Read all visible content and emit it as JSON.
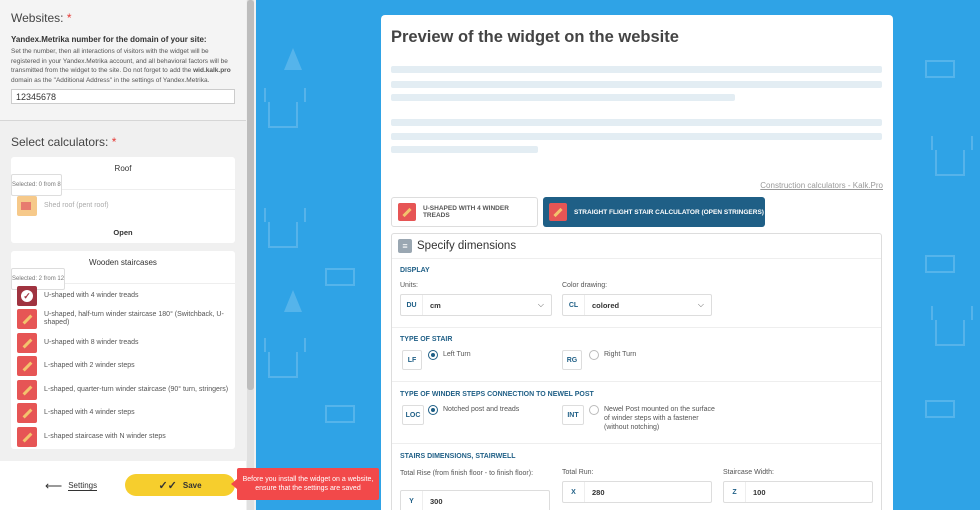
{
  "settings": {
    "websites_label": "Websites:",
    "required_mark": "*",
    "metrika_label": "Yandex.Metrika number for the domain of your site:",
    "metrika_desc_1": "Set the number, then all interactions of visitors with the widget will be registered in your Yandex.Metrika account, and all behavioral factors will be transmitted from the widget to the site. Do not forget to add the ",
    "metrika_desc_strong": "wid.kalk.pro",
    "metrika_desc_2": " domain as the \"Additional Address\" in the settings of Yandex.Metrika.",
    "metrika_value": "12345678",
    "select_calculators_label": "Select calculators:"
  },
  "calc_groups": {
    "roof": {
      "name": "Roof",
      "selected": "Selected: 0 from 8",
      "items": [
        "Shed roof (pent roof)"
      ],
      "open_label": "Open"
    },
    "stairs": {
      "name": "Wooden staircases",
      "selected": "Selected: 2 from 12",
      "items": [
        "U-shaped with 4 winder treads",
        "U-shaped, half-turn winder staircase 180° (Switchback, U-shaped)",
        "U-shaped with 8 winder treads",
        "L-shaped with 2 winder steps",
        "L-shaped, quarter-turn winder staircase (90° turn, stringers)",
        "L-shaped with 4 winder steps",
        "L-shaped staircase with N winder steps"
      ]
    }
  },
  "bottom": {
    "back_label": "Settings",
    "save_label": "Save",
    "toast": "Before you install the widget on a website, ensure that the settings are saved"
  },
  "preview": {
    "title": "Preview of the widget on the website",
    "brand_link": "Construction calculators - Kalk.Pro",
    "tabs": [
      "U-SHAPED WITH 4 WINDER TREADS",
      "STRAIGHT FLIGHT STAIR CALCULATOR (OPEN STRINGERS)"
    ],
    "form_title": "Specify dimensions",
    "display": {
      "section": "DISPLAY",
      "units_label": "Units:",
      "units_code": "DU",
      "units_value": "cm",
      "color_label": "Color drawing:",
      "color_code": "CL",
      "color_value": "colored"
    },
    "stair_type": {
      "section": "TYPE OF STAIR",
      "left_code": "LF",
      "left_label": "Left Turn",
      "right_code": "RG",
      "right_label": "Right Turn"
    },
    "winder": {
      "section": "TYPE OF WINDER STEPS CONNECTION TO NEWEL POST",
      "loc_code": "LOC",
      "loc_label": "Notched post and treads",
      "int_code": "INT",
      "int_label": "Newel Post mounted on the surface of winder steps with a fastener (without notching)"
    },
    "dims": {
      "section": "STAIRS DIMENSIONS, STAIRWELL",
      "rise_label": "Total Rise (from finish floor - to finish floor):",
      "rise_code": "Y",
      "rise_value": "300",
      "run_label": "Total Run:",
      "run_code": "X",
      "run_value": "280",
      "width_label": "Staircase Width:",
      "width_code": "Z",
      "width_value": "100"
    }
  },
  "colors": {
    "background": "#2fa3e6",
    "accent": "#1f5f86",
    "save": "#f6ce2d",
    "toast": "#f2494a",
    "required": "#e53935"
  }
}
